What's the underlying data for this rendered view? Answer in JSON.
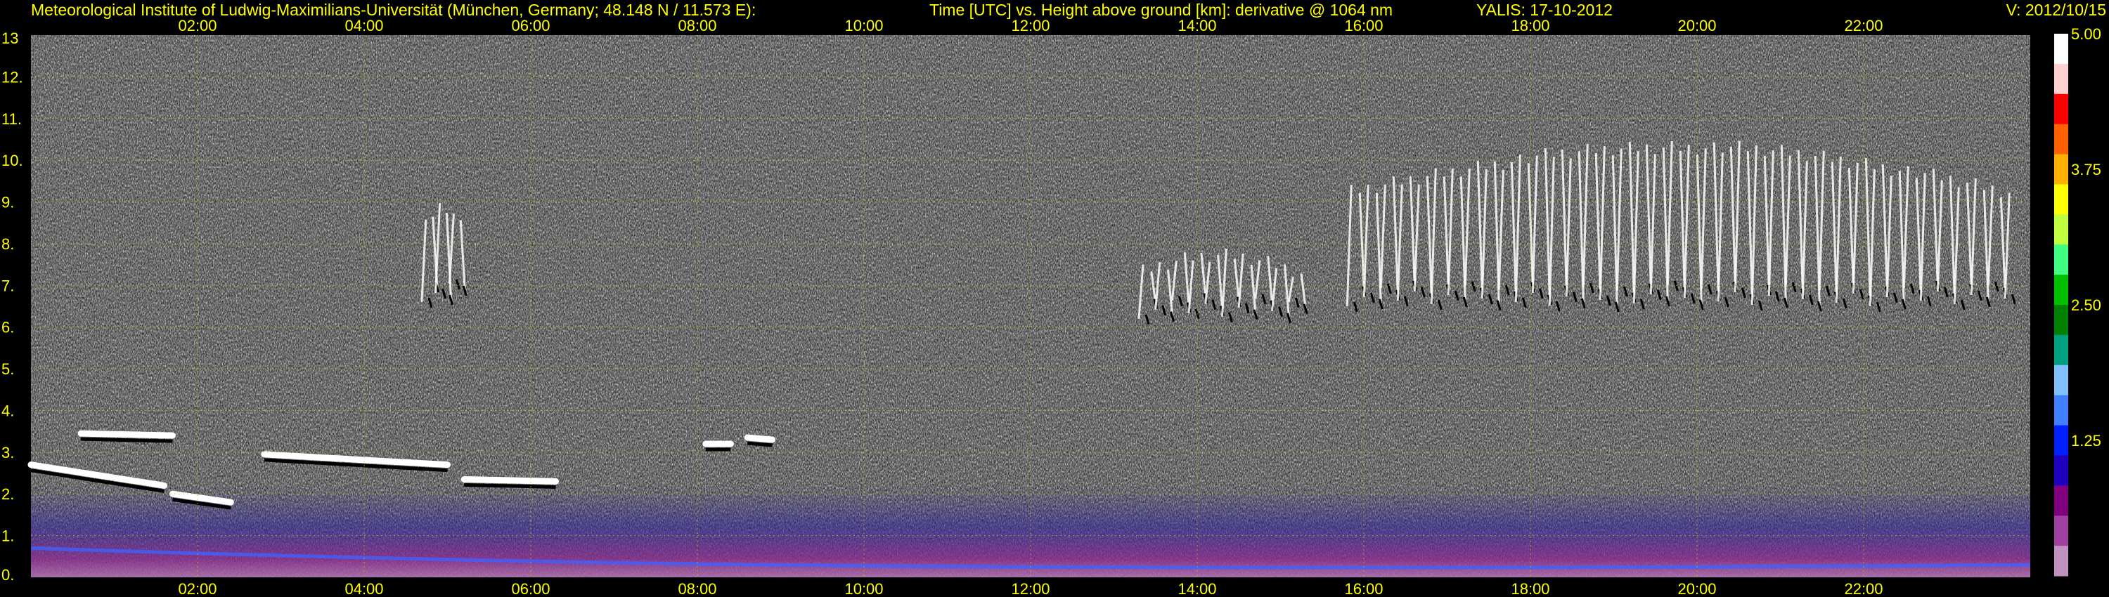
{
  "header": {
    "institute": "Meteorological Institute of Ludwig-Maximilians-Universität (München, Germany; 48.148 N / 11.573 E):",
    "axes_title": "Time [UTC] vs. Height above ground [km]: derivative @ 1064 nm",
    "station": "YALIS: 17-10-2012",
    "version": "V: 2012/10/15"
  },
  "colors": {
    "text": "#ffff00",
    "background": "#000000",
    "plot_noise": "#6b6b6b",
    "grid": "#c8c800"
  },
  "chart_data": {
    "type": "heatmap",
    "title": "Time [UTC] vs. Height above ground [km]: derivative @ 1064 nm",
    "xlabel": "Time [UTC]",
    "ylabel": "Height above ground [km]",
    "x_ticks": [
      "02:00",
      "04:00",
      "06:00",
      "08:00",
      "10:00",
      "12:00",
      "14:00",
      "16:00",
      "18:00",
      "20:00",
      "22:00"
    ],
    "x_tick_hours": [
      2,
      4,
      6,
      8,
      10,
      12,
      14,
      16,
      18,
      20,
      22
    ],
    "xlim": [
      0,
      24
    ],
    "y_ticks": [
      "0.",
      "1.",
      "2.",
      "3.",
      "4.",
      "5.",
      "6.",
      "7.",
      "8.",
      "9.",
      "10.",
      "11.",
      "12.",
      "13"
    ],
    "y_tick_values": [
      0,
      1,
      2,
      3,
      4,
      5,
      6,
      7,
      8,
      9,
      10,
      11,
      12,
      13
    ],
    "ylim": [
      0,
      13
    ],
    "grid": true,
    "colorbar": {
      "ticks": [
        "5.00",
        "3.75",
        "2.50",
        "1.25"
      ],
      "tick_values": [
        5.0,
        3.75,
        2.5,
        1.25
      ],
      "range": [
        0,
        5.0
      ],
      "palette": [
        "#ffffff",
        "#ffd0d0",
        "#ff0000",
        "#ff6000",
        "#ffb000",
        "#ffff00",
        "#c0ff40",
        "#40ff80",
        "#00c000",
        "#008000",
        "#00a080",
        "#80c0ff",
        "#4080ff",
        "#0020ff",
        "#2000c0",
        "#800080",
        "#a040a0",
        "#c090c0"
      ]
    },
    "features": [
      {
        "type": "layer",
        "t_start": 0.0,
        "t_end": 1.6,
        "h_start": 2.7,
        "h_end": 2.2
      },
      {
        "type": "layer",
        "t_start": 0.6,
        "t_end": 1.7,
        "h_start": 3.45,
        "h_end": 3.4
      },
      {
        "type": "layer",
        "t_start": 1.7,
        "t_end": 2.4,
        "h_start": 2.0,
        "h_end": 1.8
      },
      {
        "type": "layer",
        "t_start": 2.8,
        "t_end": 5.0,
        "h_start": 2.95,
        "h_end": 2.7
      },
      {
        "type": "layer",
        "t_start": 5.2,
        "t_end": 6.3,
        "h_start": 2.35,
        "h_end": 2.3
      },
      {
        "type": "layer",
        "t_start": 8.1,
        "t_end": 8.4,
        "h_start": 3.2,
        "h_end": 3.2
      },
      {
        "type": "layer",
        "t_start": 8.6,
        "t_end": 8.9,
        "h_start": 3.35,
        "h_end": 3.3
      },
      {
        "type": "cloud",
        "t_start": 4.7,
        "t_end": 5.2,
        "h_start": 9.3,
        "h_end": 6.6
      },
      {
        "type": "cloud",
        "t_start": 13.3,
        "t_end": 15.3,
        "h_start": 8.0,
        "h_end": 6.2
      },
      {
        "type": "cloud",
        "t_start": 15.8,
        "t_end": 23.8,
        "h_start": 11.0,
        "h_end": 6.5
      }
    ]
  }
}
